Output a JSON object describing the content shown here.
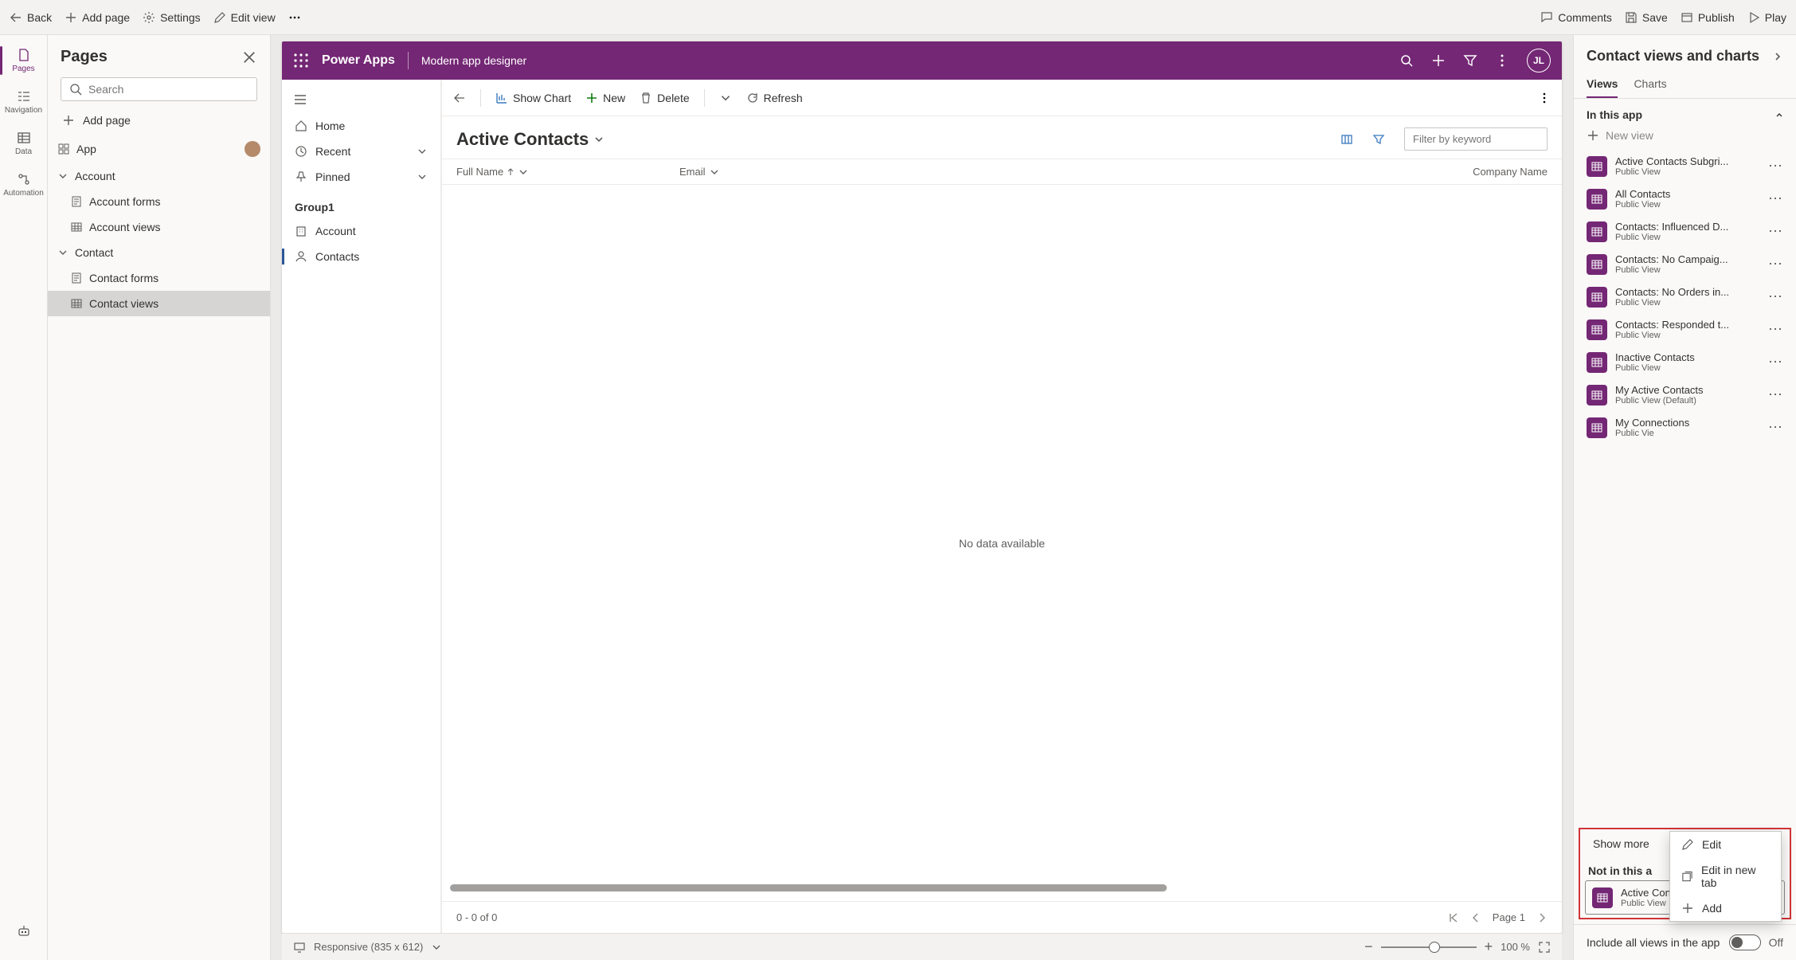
{
  "topbar": {
    "back": "Back",
    "add_page": "Add page",
    "settings": "Settings",
    "edit_view": "Edit view",
    "comments": "Comments",
    "save": "Save",
    "publish": "Publish",
    "play": "Play"
  },
  "rail": {
    "pages": "Pages",
    "navigation": "Navigation",
    "data": "Data",
    "automation": "Automation"
  },
  "pages_panel": {
    "title": "Pages",
    "search_ph": "Search",
    "add_page": "Add page",
    "tree": {
      "app": "App",
      "account": "Account",
      "account_forms": "Account forms",
      "account_views": "Account views",
      "contact": "Contact",
      "contact_forms": "Contact forms",
      "contact_views": "Contact views"
    }
  },
  "app": {
    "brand": "Power Apps",
    "subtitle": "Modern app designer",
    "avatar": "JL",
    "sitemap": {
      "home": "Home",
      "recent": "Recent",
      "pinned": "Pinned",
      "group": "Group1",
      "account": "Account",
      "contacts": "Contacts"
    },
    "cmd": {
      "show_chart": "Show Chart",
      "new": "New",
      "delete": "Delete",
      "refresh": "Refresh"
    },
    "view_title": "Active Contacts",
    "filter_ph": "Filter by keyword",
    "cols": {
      "fullname": "Full Name",
      "email": "Email",
      "company": "Company Name"
    },
    "empty": "No data available",
    "pager": {
      "count": "0 - 0 of 0",
      "page": "Page 1"
    }
  },
  "status": {
    "responsive": "Responsive (835 x 612)",
    "zoom": "100 %"
  },
  "right": {
    "title": "Contact views and charts",
    "tabs": {
      "views": "Views",
      "charts": "Charts"
    },
    "sec_in": "In this app",
    "new_view": "New view",
    "views": [
      {
        "name": "Active Contacts Subgri...",
        "sub": "Public View"
      },
      {
        "name": "All Contacts",
        "sub": "Public View"
      },
      {
        "name": "Contacts: Influenced D...",
        "sub": "Public View"
      },
      {
        "name": "Contacts: No Campaig...",
        "sub": "Public View"
      },
      {
        "name": "Contacts: No Orders in...",
        "sub": "Public View"
      },
      {
        "name": "Contacts: Responded t...",
        "sub": "Public View"
      },
      {
        "name": "Inactive Contacts",
        "sub": "Public View"
      },
      {
        "name": "My Active Contacts",
        "sub": "Public View (Default)"
      },
      {
        "name": "My Connections",
        "sub": "Public Vie"
      }
    ],
    "show_more": "Show more",
    "sec_not": "Not in this a",
    "not_view": {
      "name": "Active Contacts",
      "sub": "Public View"
    },
    "menu": {
      "edit": "Edit",
      "edit_tab": "Edit in new tab",
      "add": "Add"
    },
    "include": "Include all views in the app",
    "off": "Off"
  }
}
